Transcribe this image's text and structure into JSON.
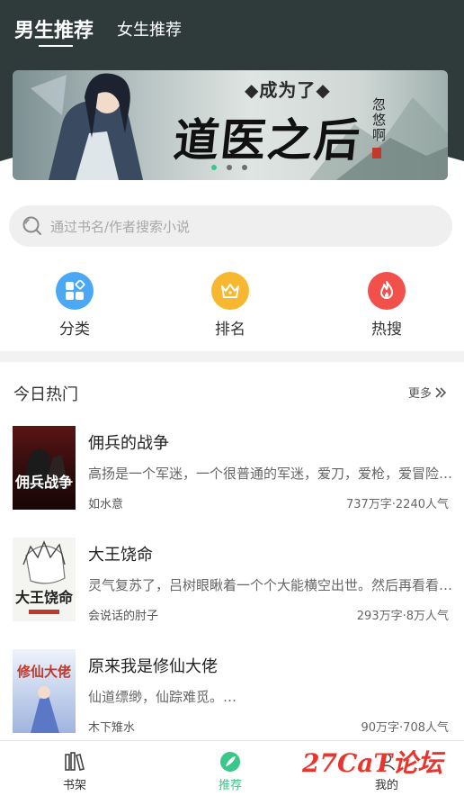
{
  "header": {
    "tabs": [
      {
        "label": "男生推荐",
        "active": true
      },
      {
        "label": "女生推荐",
        "active": false
      }
    ]
  },
  "banner": {
    "pre_title": "◆成为了◆",
    "title": "道医之后",
    "author": "忽悠啊",
    "slide_count": 3,
    "active_slide": 1
  },
  "search": {
    "placeholder": "通过书名/作者搜索小说"
  },
  "quick_entries": [
    {
      "label": "分类",
      "icon": "category-icon",
      "color": "#4aa8f5"
    },
    {
      "label": "排名",
      "icon": "crown-icon",
      "color": "#f7b731"
    },
    {
      "label": "热搜",
      "icon": "flame-icon",
      "color": "#f2504a"
    }
  ],
  "section": {
    "title": "今日热门",
    "more_label": "更多"
  },
  "books": [
    {
      "title": "佣兵的战争",
      "desc": "高扬是一个军迷，一个很普通的军迷，爱刀，爱枪，爱冒险，爱…",
      "author": "如水意",
      "stats": "737万字·2240人气",
      "cover_text": "佣兵战争"
    },
    {
      "title": "大王饶命",
      "desc": "灵气复苏了，吕树眼瞅着一个个大能横空出世。然后再看看自己…",
      "author": "会说话的肘子",
      "stats": "293万字·8万人气",
      "cover_text": "大王饶命"
    },
    {
      "title": "原来我是修仙大佬",
      "desc": "仙道缥缈，仙踪难觅。…",
      "author": "木下雉水",
      "stats": "90万字·708人气",
      "cover_text": "修仙大佬"
    }
  ],
  "bottom_nav": [
    {
      "label": "书架",
      "icon": "bookshelf-icon",
      "active": false
    },
    {
      "label": "推荐",
      "icon": "recommend-icon",
      "active": true
    },
    {
      "label": "我的",
      "icon": "profile-icon",
      "active": false
    }
  ],
  "watermark": "27CaT论坛",
  "colors": {
    "header_bg": "#2f3b3b",
    "accent": "#3cc78a"
  }
}
